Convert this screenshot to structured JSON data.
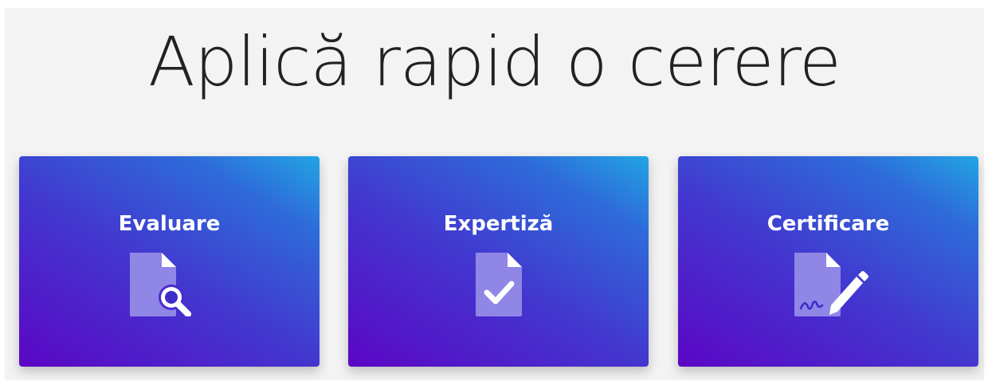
{
  "heading": "Aplică rapid o cerere",
  "cards": [
    {
      "label": "Evaluare",
      "icon": "document-search-icon"
    },
    {
      "label": "Expertiză",
      "icon": "document-check-icon"
    },
    {
      "label": "Certificare",
      "icon": "document-signature-icon"
    }
  ],
  "colors": {
    "background": "#f3f3f3",
    "card_gradient_start": "#5b06c4",
    "card_gradient_end": "#22a5e4",
    "icon_fill": "#8f86e6",
    "text": "#ffffff"
  }
}
